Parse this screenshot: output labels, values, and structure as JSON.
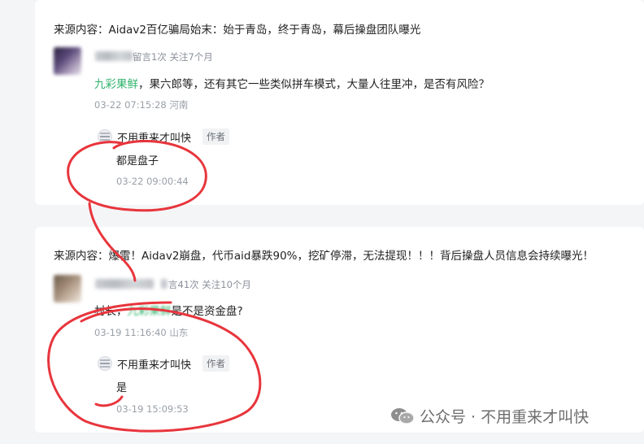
{
  "cards": [
    {
      "source_text": "来源内容：Aidav2百亿骗局始末：始于青岛，终于青岛，幕后操盘团队曝光",
      "commenter_meta": "留言1次 关注7个月",
      "comment_mention": "九彩果鲜",
      "comment_text": "，果六郎等，还有其它一些类似拼车模式，大量人往里冲，是否有风险？",
      "comment_time": "03-22 07:15:28 河南",
      "reply_name": "不用重来才叫快",
      "author_tag": "作者",
      "reply_text": "都是盘子",
      "reply_time": "03-22 09:00:44"
    },
    {
      "source_text": "来源内容：爆雷！Aidav2崩盘，代币aid暴跌90%，挖矿停滞，无法提现！！！背后操盘人员信息会持续曝光！",
      "commenter_meta": "言41次 关注10个月",
      "comment_prefix": "村长，",
      "comment_mention": "九彩果鲜",
      "comment_text": "是不是资金盘?",
      "comment_time": "03-19 11:16:40 山东",
      "reply_name": "不用重来才叫快",
      "author_tag": "作者",
      "reply_text": "是",
      "reply_time": "03-19 15:09:53"
    }
  ],
  "watermark": {
    "text": "公众号 · 不用重来才叫快",
    "icon": "wechat-icon"
  },
  "colors": {
    "mention": "#2fb36b",
    "annotation": "#e8353c",
    "meta": "#8a8f99"
  }
}
